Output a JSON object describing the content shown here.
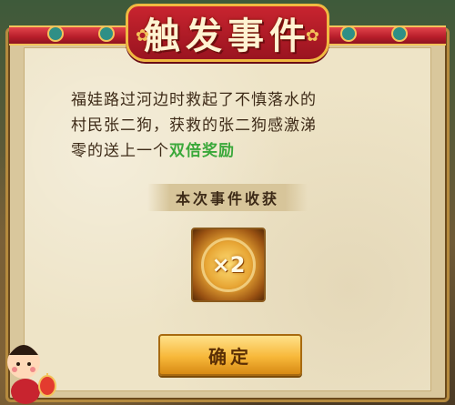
{
  "title": "触发事件",
  "story": {
    "line1": "福娃路过河边时救起了不慎落水的",
    "line2": "村民张二狗，获救的张二狗感激涕",
    "line3_prefix": "零的送上一个",
    "line3_highlight": "双倍奖励"
  },
  "section_label": "本次事件收获",
  "reward": {
    "text": "×2",
    "icon": "double-reward-icon"
  },
  "confirm_label": "确定",
  "colors": {
    "highlight": "#3aa83a",
    "title_red": "#c8242f",
    "button_gold": "#f7b83a"
  }
}
